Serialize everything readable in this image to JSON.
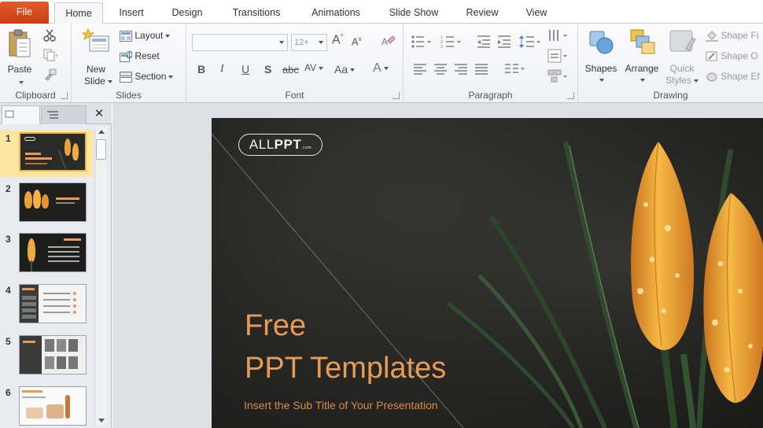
{
  "tabs": [
    {
      "label": "File"
    },
    {
      "label": "Home"
    },
    {
      "label": "Insert"
    },
    {
      "label": "Design"
    },
    {
      "label": "Transitions"
    },
    {
      "label": "Animations"
    },
    {
      "label": "Slide Show"
    },
    {
      "label": "Review"
    },
    {
      "label": "View"
    }
  ],
  "ribbon": {
    "clipboard": {
      "paste": "Paste",
      "group": "Clipboard"
    },
    "slides": {
      "new_slide_1": "New",
      "new_slide_2": "Slide",
      "layout": "Layout",
      "reset": "Reset",
      "section": "Section",
      "group": "Slides"
    },
    "font": {
      "size": "12+",
      "bold": "B",
      "italic": "I",
      "underline": "U",
      "shadow": "S",
      "strike": "abc",
      "spacing": "AV",
      "case": "Aa",
      "color": "A",
      "grow": "A",
      "shrink": "A",
      "group": "Font"
    },
    "paragraph": {
      "group": "Paragraph"
    },
    "drawing": {
      "shapes": "Shapes",
      "arrange": "Arrange",
      "quick_1": "Quick",
      "quick_2": "Styles",
      "fill": "Shape Fi",
      "outline": "Shape O",
      "effects": "Shape Ef",
      "group": "Drawing"
    }
  },
  "slides_panel": {
    "numbers": [
      "1",
      "2",
      "3",
      "4",
      "5",
      "6"
    ],
    "selected": 1,
    "close_glyph": "✕"
  },
  "slide": {
    "logo_light": "ALL",
    "logo_bold": "PPT",
    "logo_tiny": ".com",
    "title_line1": "Free",
    "title_line2": "PPT Templates",
    "subtitle": "Insert the Sub Title of Your Presentation"
  },
  "colors": {
    "file_tab": "#d04a1d",
    "title_text": "#e79b55",
    "selected_thumb": "#fde6a4"
  }
}
